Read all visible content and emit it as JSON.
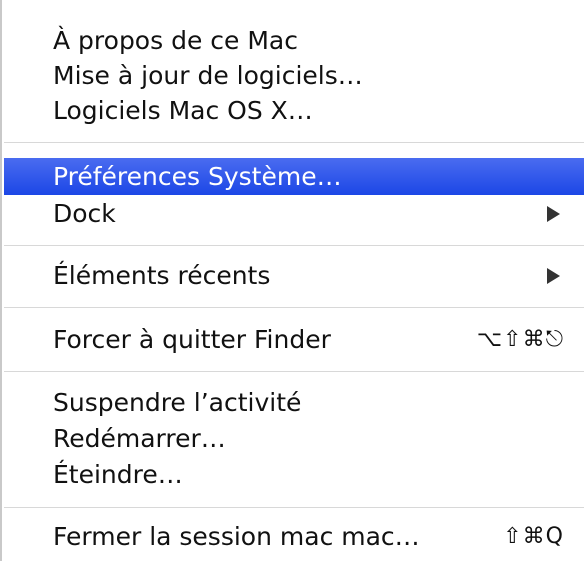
{
  "menu": {
    "group1": {
      "about": "À propos de ce Mac",
      "software_update": "Mise à jour de logiciels…",
      "mac_os_x_software": "Logiciels Mac OS X…"
    },
    "group2": {
      "system_preferences": "Préférences Système…",
      "dock": "Dock"
    },
    "group3": {
      "recent_items": "Éléments récents"
    },
    "group4": {
      "force_quit": "Forcer à quitter Finder",
      "force_quit_shortcut": "⌥⇧⌘⎋"
    },
    "group5": {
      "sleep": "Suspendre l’activité",
      "restart": "Redémarrer…",
      "shut_down": "Éteindre…"
    },
    "group6": {
      "log_out": "Fermer la session mac mac…",
      "log_out_shortcut": "⇧⌘Q"
    },
    "highlight_color": "#1c47e6"
  }
}
